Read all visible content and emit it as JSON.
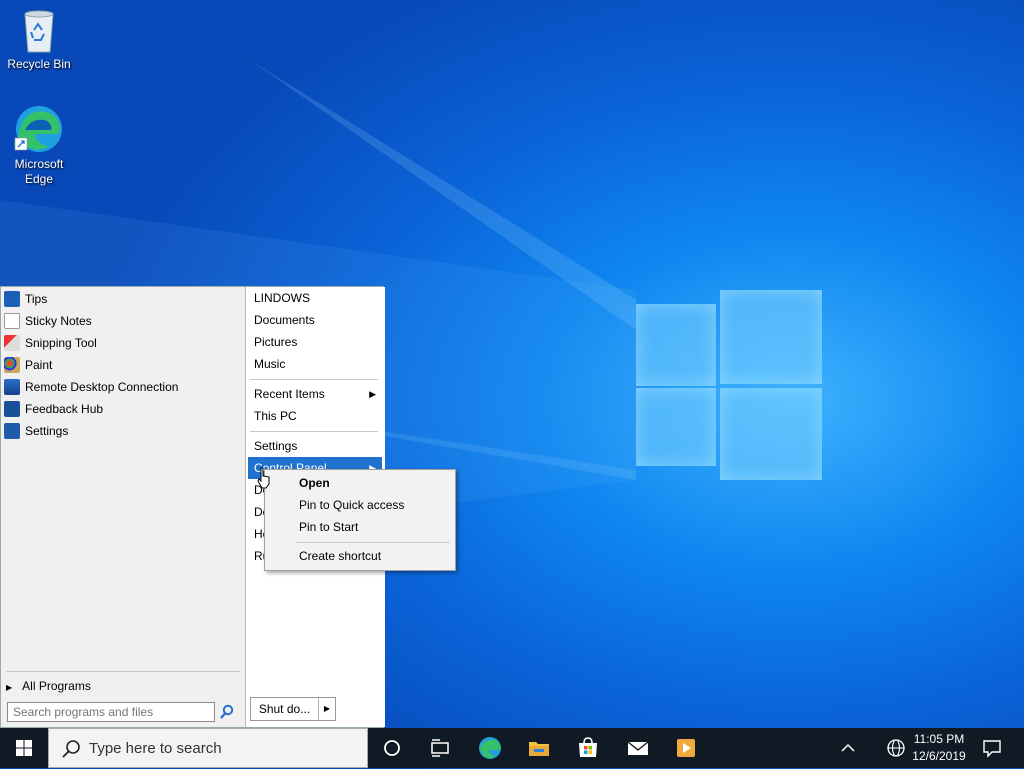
{
  "desktop": {
    "icons": [
      {
        "label": "Recycle Bin"
      },
      {
        "label": "Microsoft Edge"
      }
    ]
  },
  "start_menu": {
    "programs": [
      "Tips",
      "Sticky Notes",
      "Snipping Tool",
      "Paint",
      "Remote Desktop Connection",
      "Feedback Hub",
      "Settings"
    ],
    "all_programs": "All Programs",
    "search_placeholder": "Search programs and files",
    "right_links": {
      "user": "LINDOWS",
      "documents": "Documents",
      "pictures": "Pictures",
      "music": "Music",
      "recent_items": "Recent Items",
      "this_pc": "This PC",
      "settings": "Settings",
      "control_panel": "Control Panel",
      "partial_1": "De",
      "partial_2": "De",
      "partial_3": "He",
      "partial_4": "Ru"
    },
    "shutdown_label": "Shut do..."
  },
  "context_menu": {
    "items": [
      "Open",
      "Pin to Quick access",
      "Pin to Start",
      "Create shortcut"
    ]
  },
  "taskbar": {
    "search_placeholder": "Type here to search",
    "time": "11:05 PM",
    "date": "12/6/2019"
  },
  "colors": {
    "highlight": "#1f72d0",
    "taskbar": "#101a24"
  }
}
